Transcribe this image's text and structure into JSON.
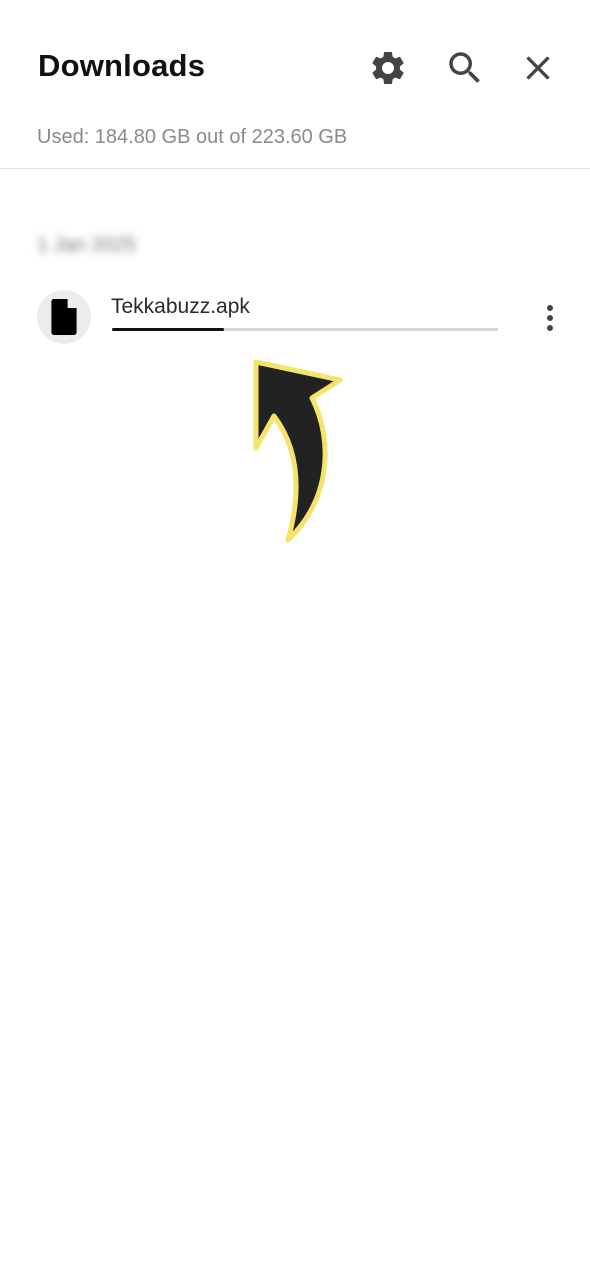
{
  "header": {
    "title": "Downloads",
    "storage_text": "Used: 184.80 GB out of 223.60 GB",
    "icons": [
      "gear-icon",
      "search-icon",
      "close-icon"
    ]
  },
  "downloads": {
    "date_header": "1 Jan 2025",
    "items": [
      {
        "file_name": "Tekkabuzz.apk",
        "icon": "file-icon",
        "progress": 0.29
      }
    ]
  },
  "annotation": {
    "arrow_fill": "#222222",
    "arrow_outline": "#f6e36b"
  }
}
